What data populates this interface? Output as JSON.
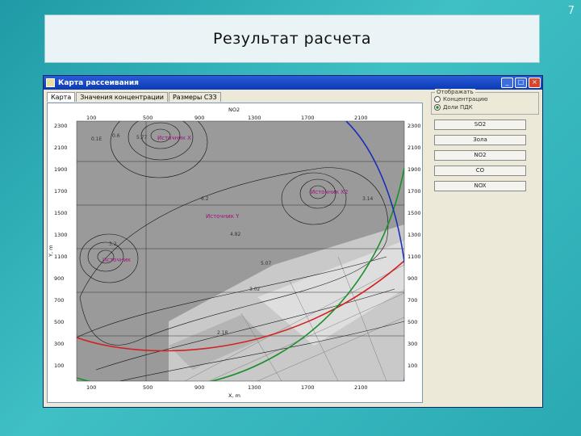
{
  "slide": {
    "number": "7",
    "title": "Результат расчета"
  },
  "window": {
    "title": "Карта рассеивания",
    "controls": [
      "_",
      "□",
      "×"
    ],
    "tabs": [
      "Карта",
      "Значения концентрации",
      "Размеры СЗЗ"
    ]
  },
  "map": {
    "pollutant": "NO2",
    "x_axis_label": "X, m",
    "y_axis_label": "Y, m",
    "x_ticks": [
      "100",
      "500",
      "900",
      "1300",
      "1700",
      "2100"
    ],
    "y_ticks": [
      "2300",
      "2100",
      "1900",
      "1700",
      "1500",
      "1300",
      "1100",
      "900",
      "700",
      "500",
      "300",
      "100"
    ],
    "y_ticks_right": [
      "2300",
      "2100",
      "1900",
      "1700",
      "1500",
      "1300",
      "1100",
      "900",
      "700",
      "500",
      "300",
      "100"
    ],
    "sources": [
      {
        "label": "Источник X"
      },
      {
        "label": "Источник X2"
      },
      {
        "label": "Источник Y"
      },
      {
        "label": "Источник"
      }
    ],
    "contour_labels": [
      "0.1E",
      "0.6",
      "5.77",
      "6.2",
      "4.82",
      "5.07",
      "3.2",
      "3.02",
      "2.18",
      "3.14"
    ],
    "colors": {
      "red_circle": "#d42020",
      "green_circle": "#1a8f2a",
      "blue_circle": "#1a2fb8",
      "source_label": "#a01080"
    }
  },
  "panel": {
    "display_group_title": "Отображать",
    "radio_options": [
      {
        "label": "Концентрацию",
        "selected": false
      },
      {
        "label": "Доли ПДК",
        "selected": true
      }
    ],
    "substance_buttons": [
      "SO2",
      "Зола",
      "NO2",
      "CO",
      "NOX"
    ]
  }
}
